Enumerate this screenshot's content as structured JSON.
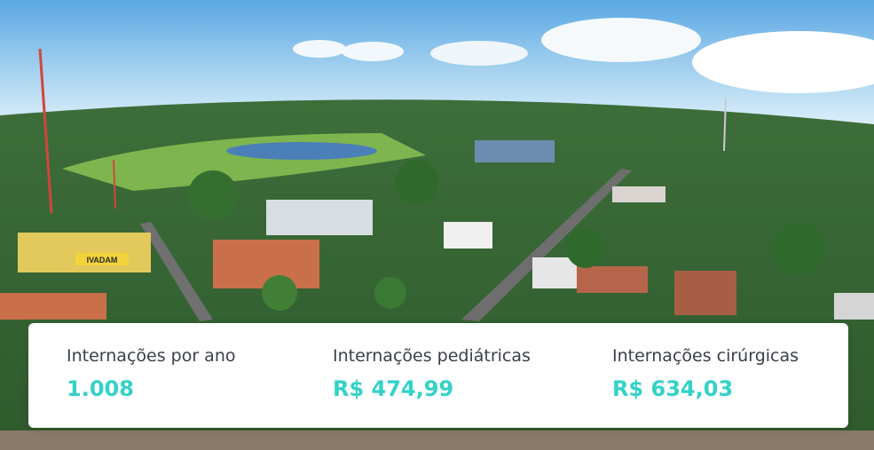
{
  "background": {
    "sky": "#9fd0ef",
    "vegetation": "#4f8a3c",
    "field": "#7fb54f",
    "pond": "#4b7fb8",
    "roof": "#c9704a",
    "road": "#6e6e6e"
  },
  "signage": {
    "store": "IVADAM"
  },
  "stats": [
    {
      "label": "Internações por ano",
      "value": "1.008"
    },
    {
      "label": "Internações pediátricas",
      "value": "R$ 474,99"
    },
    {
      "label": "Internações cirúrgicas",
      "value": "R$ 634,03"
    }
  ],
  "accent_color": "#33d2c8"
}
